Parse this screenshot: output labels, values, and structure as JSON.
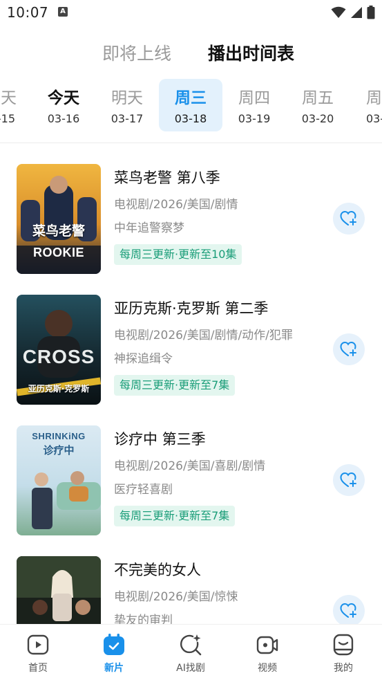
{
  "status_bar": {
    "time": "10:07",
    "app_icon_letter": "A"
  },
  "top_tabs": [
    {
      "label": "即将上线",
      "active": false
    },
    {
      "label": "播出时间表",
      "active": true
    }
  ],
  "dates": [
    {
      "weekday": "天",
      "date": "-15"
    },
    {
      "weekday": "今天",
      "date": "03-16"
    },
    {
      "weekday": "明天",
      "date": "03-17"
    },
    {
      "weekday": "周三",
      "date": "03-18"
    },
    {
      "weekday": "周四",
      "date": "03-19"
    },
    {
      "weekday": "周五",
      "date": "03-20"
    },
    {
      "weekday": "周",
      "date": "03-"
    }
  ],
  "shows": [
    {
      "title": "菜鸟老警 第八季",
      "meta": "电视剧/2026/美国/剧情",
      "desc": "中年追警察梦",
      "badge": "每周三更新·更新至10集",
      "poster_text": "菜鸟老警",
      "poster_sub": "ROOKIE",
      "poster_colors": [
        "#e9a83a",
        "#2a2f3a"
      ]
    },
    {
      "title": "亚历克斯·克罗斯 第二季",
      "meta": "电视剧/2026/美国/剧情/动作/犯罪",
      "desc": "神探追缉令",
      "badge": "每周三更新·更新至7集",
      "poster_text": "CROSS",
      "poster_sub": "亚历克斯·克罗斯",
      "poster_colors": [
        "#1d3a48",
        "#0b1418"
      ]
    },
    {
      "title": "诊疗中 第三季",
      "meta": "电视剧/2026/美国/喜剧/剧情",
      "desc": "医疗轻喜剧",
      "badge": "每周三更新·更新至7集",
      "poster_text": "SHRINKiNG",
      "poster_sub": "诊疗中",
      "poster_colors": [
        "#cfe4f0",
        "#8dbfa8"
      ]
    },
    {
      "title": "不完美的女人",
      "meta": "电视剧/2026/美国/惊悚",
      "desc": "挚友的审判",
      "badge": "",
      "poster_text": "",
      "poster_sub": "",
      "poster_colors": [
        "#2e3a2a",
        "#121614"
      ]
    }
  ],
  "bottom_nav": [
    {
      "label": "首页",
      "icon": "play-square-icon",
      "active": false
    },
    {
      "label": "新片",
      "icon": "calendar-check-icon",
      "active": true
    },
    {
      "label": "AI找剧",
      "icon": "ai-search-icon",
      "active": false
    },
    {
      "label": "视频",
      "icon": "video-camera-icon",
      "active": false
    },
    {
      "label": "我的",
      "icon": "profile-icon",
      "active": false
    }
  ],
  "colors": {
    "accent": "#1990ea",
    "badge_bg": "#e3f6ef",
    "badge_text": "#1a9d78",
    "selected_date_bg": "#e3f1fc"
  }
}
